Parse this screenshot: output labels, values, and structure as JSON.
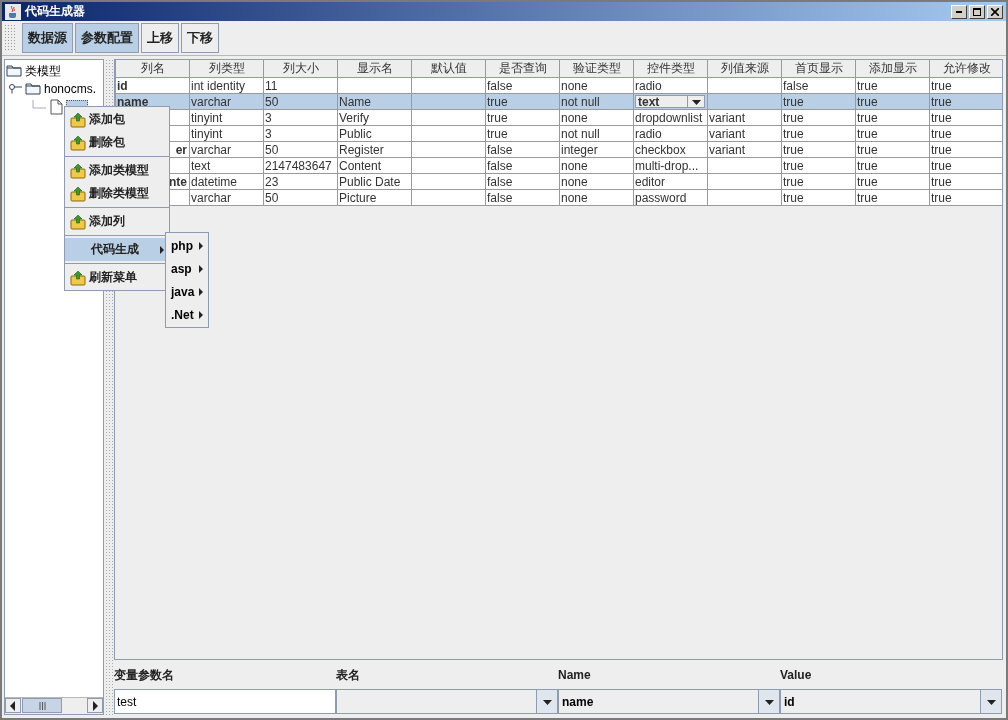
{
  "window": {
    "title": "代码生成器"
  },
  "toolbar": {
    "buttons": [
      {
        "label": "数据源",
        "selected": true
      },
      {
        "label": "参数配置",
        "selected": true
      },
      {
        "label": "上移",
        "selected": false
      },
      {
        "label": "下移",
        "selected": false
      }
    ]
  },
  "tree": {
    "label": "类模型",
    "children": [
      {
        "label": "honocms.",
        "expanded": true,
        "children": [
          {
            "kind": "file",
            "selected": true
          }
        ]
      }
    ]
  },
  "table": {
    "columns": [
      "列名",
      "列类型",
      "列大小",
      "显示名",
      "默认值",
      "是否查询",
      "验证类型",
      "控件类型",
      "列值来源",
      "首页显示",
      "添加显示",
      "允许修改"
    ],
    "rows": [
      {
        "selected": false,
        "cells": [
          "id",
          "int identity",
          "11",
          "",
          "",
          "false",
          "none",
          "radio",
          "",
          "false",
          "true",
          "true"
        ]
      },
      {
        "selected": true,
        "cells": [
          "name",
          "varchar",
          "50",
          "Name",
          "",
          "true",
          "not null",
          {
            "kind": "combo",
            "text": "text"
          },
          "",
          "true",
          "true",
          "true"
        ]
      },
      {
        "selected": false,
        "cells": [
          {
            "kind": "covered"
          },
          "tinyint",
          "3",
          "Verify",
          "",
          "true",
          "none",
          "dropdownlist",
          "variant",
          "true",
          "true",
          "true"
        ]
      },
      {
        "selected": false,
        "cells": [
          {
            "kind": "covered"
          },
          "tinyint",
          "3",
          "Public",
          "",
          "true",
          "not null",
          "radio",
          "variant",
          "true",
          "true",
          "true"
        ]
      },
      {
        "selected": false,
        "cells": [
          {
            "kind": "tail",
            "text": "er"
          },
          "varchar",
          "50",
          "Register",
          "",
          "false",
          "integer",
          "checkbox",
          "variant",
          "true",
          "true",
          "true"
        ]
      },
      {
        "selected": false,
        "cells": [
          {
            "kind": "covered"
          },
          "text",
          "2147483647",
          "Content",
          "",
          "false",
          "none",
          "multi-drop...",
          "",
          "true",
          "true",
          "true"
        ]
      },
      {
        "selected": false,
        "cells": [
          {
            "kind": "tail",
            "text": "nte"
          },
          "datetime",
          "23",
          "Public Date",
          "",
          "false",
          "none",
          "editor",
          "",
          "true",
          "true",
          "true"
        ]
      },
      {
        "selected": false,
        "cells": [
          {
            "kind": "covered"
          },
          "varchar",
          "50",
          "Picture",
          "",
          "false",
          "none",
          "password",
          "",
          "true",
          "true",
          "true"
        ]
      }
    ]
  },
  "form": {
    "fields": [
      {
        "label": "变量参数名",
        "kind": "text",
        "value": "test"
      },
      {
        "label": "表名",
        "kind": "combo"
      },
      {
        "label": "Name",
        "kind": "combo",
        "value": "name"
      },
      {
        "label": "Value",
        "kind": "combo",
        "value": "id"
      }
    ]
  },
  "context_menu": {
    "items": [
      {
        "kind": "item",
        "label": "添加包",
        "selected": false
      },
      {
        "kind": "item",
        "label": "删除包",
        "selected": false
      },
      {
        "kind": "separator"
      },
      {
        "kind": "item",
        "label": "添加类模型",
        "selected": false
      },
      {
        "kind": "item",
        "label": "删除类模型",
        "selected": false
      },
      {
        "kind": "separator"
      },
      {
        "kind": "item",
        "label": "添加列",
        "selected": false
      },
      {
        "kind": "separator"
      },
      {
        "kind": "submenu",
        "label": "代码生成",
        "selected": true
      },
      {
        "kind": "separator"
      },
      {
        "kind": "item",
        "label": "刷新菜单",
        "selected": false
      }
    ]
  },
  "submenu": {
    "items": [
      {
        "label": "php"
      },
      {
        "label": "asp"
      },
      {
        "label": "java"
      },
      {
        "label": ".Net"
      }
    ]
  }
}
